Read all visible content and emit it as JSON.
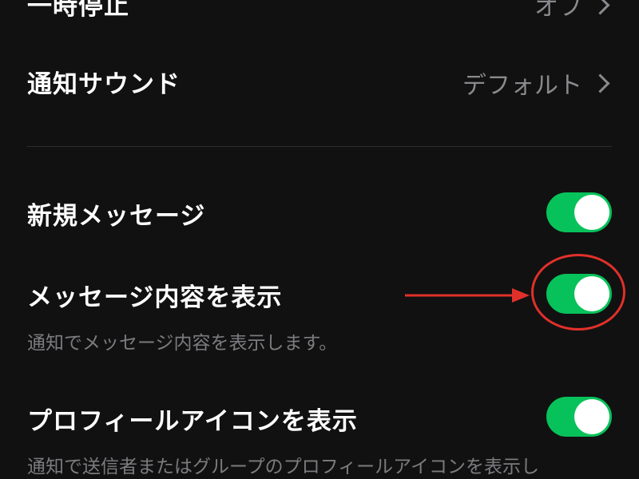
{
  "settings": {
    "pause": {
      "label": "一時停止",
      "value": "オフ"
    },
    "sound": {
      "label": "通知サウンド",
      "value": "デフォルト"
    },
    "new_message": {
      "label": "新規メッセージ",
      "enabled": true
    },
    "show_content": {
      "label": "メッセージ内容を表示",
      "description": "通知でメッセージ内容を表示します。",
      "enabled": true
    },
    "show_profile_icon": {
      "label": "プロフィールアイコンを表示",
      "description": "通知で送信者またはグループのプロフィールアイコンを表示し",
      "enabled": true
    }
  },
  "colors": {
    "background": "#111111",
    "toggle_on": "#07c25a",
    "annotation": "#e1302a",
    "secondary_text": "#8a8a8e"
  },
  "icons": {
    "chevron": "chevron-right-icon"
  }
}
